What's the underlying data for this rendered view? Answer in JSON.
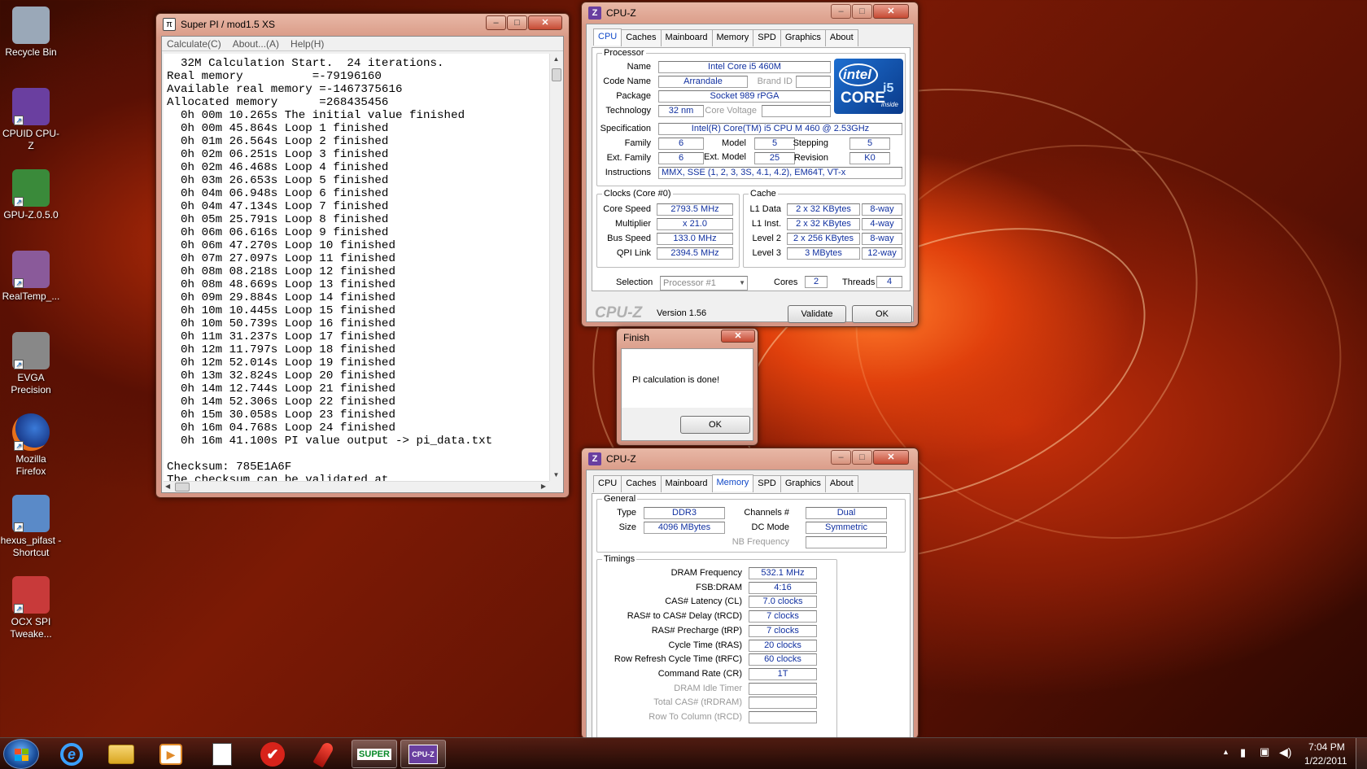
{
  "desktop": {
    "icons": [
      {
        "label_1": "Recycle Bin",
        "label_2": ""
      },
      {
        "label_1": "CPUID CPU-Z",
        "label_2": ""
      },
      {
        "label_1": "GPU-Z.0.5.0",
        "label_2": ""
      },
      {
        "label_1": "RealTemp_...",
        "label_2": ""
      },
      {
        "label_1": "EVGA",
        "label_2": "Precision"
      },
      {
        "label_1": "Mozilla",
        "label_2": "Firefox"
      },
      {
        "label_1": "hexus_pifast -",
        "label_2": "Shortcut"
      },
      {
        "label_1": "OCX SPI",
        "label_2": "Tweake..."
      }
    ]
  },
  "superpi": {
    "title": "Super PI / mod1.5 XS",
    "menu": [
      "Calculate(C)",
      "About...(A)",
      "Help(H)"
    ],
    "lines": [
      "  32M Calculation Start.  24 iterations.",
      "Real memory          =-79196160",
      "Available real memory =-1467375616",
      "Allocated memory      =268435456",
      "  0h 00m 10.265s The initial value finished",
      "  0h 00m 45.864s Loop 1 finished",
      "  0h 01m 26.564s Loop 2 finished",
      "  0h 02m 06.251s Loop 3 finished",
      "  0h 02m 46.468s Loop 4 finished",
      "  0h 03m 26.653s Loop 5 finished",
      "  0h 04m 06.948s Loop 6 finished",
      "  0h 04m 47.134s Loop 7 finished",
      "  0h 05m 25.791s Loop 8 finished",
      "  0h 06m 06.616s Loop 9 finished",
      "  0h 06m 47.270s Loop 10 finished",
      "  0h 07m 27.097s Loop 11 finished",
      "  0h 08m 08.218s Loop 12 finished",
      "  0h 08m 48.669s Loop 13 finished",
      "  0h 09m 29.884s Loop 14 finished",
      "  0h 10m 10.445s Loop 15 finished",
      "  0h 10m 50.739s Loop 16 finished",
      "  0h 11m 31.237s Loop 17 finished",
      "  0h 12m 11.797s Loop 18 finished",
      "  0h 12m 52.014s Loop 19 finished",
      "  0h 13m 32.824s Loop 20 finished",
      "  0h 14m 12.744s Loop 21 finished",
      "  0h 14m 52.306s Loop 22 finished",
      "  0h 15m 30.058s Loop 23 finished",
      "  0h 16m 04.768s Loop 24 finished",
      "  0h 16m 41.100s PI value output -> pi_data.txt",
      "",
      "Checksum: 785E1A6F",
      "The checksum can be validated at"
    ]
  },
  "cpuz_cpu": {
    "title": "CPU-Z",
    "tabs": [
      "CPU",
      "Caches",
      "Mainboard",
      "Memory",
      "SPD",
      "Graphics",
      "About"
    ],
    "processor_group": "Processor",
    "name_label": "Name",
    "name": "Intel Core i5 460M",
    "codename_label": "Code Name",
    "codename": "Arrandale",
    "brandid_label": "Brand ID",
    "brandid": "",
    "package_label": "Package",
    "package": "Socket 989 rPGA",
    "technology_label": "Technology",
    "technology": "32 nm",
    "corevoltage_label": "Core Voltage",
    "corevoltage": "",
    "spec_label": "Specification",
    "spec": "Intel(R) Core(TM) i5 CPU       M 460  @ 2.53GHz",
    "family_label": "Family",
    "family": "6",
    "model_label": "Model",
    "model": "5",
    "stepping_label": "Stepping",
    "stepping": "5",
    "extfamily_label": "Ext. Family",
    "extfamily": "6",
    "extmodel_label": "Ext. Model",
    "extmodel": "25",
    "revision_label": "Revision",
    "revision": "K0",
    "instructions_label": "Instructions",
    "instructions": "MMX, SSE (1, 2, 3, 3S, 4.1, 4.2), EM64T, VT-x",
    "logo": {
      "brand": "intel",
      "line": "CORE",
      "model": "i5",
      "tag": "inside"
    },
    "clocks_group": "Clocks (Core #0)",
    "corespeed_label": "Core Speed",
    "corespeed": "2793.5 MHz",
    "multiplier_label": "Multiplier",
    "multiplier": "x 21.0",
    "busspeed_label": "Bus Speed",
    "busspeed": "133.0 MHz",
    "qpilink_label": "QPI Link",
    "qpilink": "2394.5 MHz",
    "cache_group": "Cache",
    "l1d_label": "L1 Data",
    "l1d": "2 x 32 KBytes",
    "l1d_way": "8-way",
    "l1i_label": "L1 Inst.",
    "l1i": "2 x 32 KBytes",
    "l1i_way": "4-way",
    "l2_label": "Level 2",
    "l2": "2 x 256 KBytes",
    "l2_way": "8-way",
    "l3_label": "Level 3",
    "l3": "3 MBytes",
    "l3_way": "12-way",
    "selection_label": "Selection",
    "selection": "Processor #1",
    "cores_label": "Cores",
    "cores": "2",
    "threads_label": "Threads",
    "threads": "4",
    "brand_text": "CPU-Z",
    "version": "Version 1.56",
    "validate": "Validate",
    "ok": "OK"
  },
  "finish": {
    "title": "Finish",
    "message": "PI calculation is done!",
    "ok": "OK"
  },
  "cpuz_mem": {
    "title": "CPU-Z",
    "tabs": [
      "CPU",
      "Caches",
      "Mainboard",
      "Memory",
      "SPD",
      "Graphics",
      "About"
    ],
    "general_group": "General",
    "type_label": "Type",
    "type": "DDR3",
    "size_label": "Size",
    "size": "4096 MBytes",
    "channels_label": "Channels #",
    "channels": "Dual",
    "dcmode_label": "DC Mode",
    "dcmode": "Symmetric",
    "nbfreq_label": "NB Frequency",
    "nbfreq": "",
    "timings_group": "Timings",
    "timings": [
      {
        "label": "DRAM Frequency",
        "value": "532.1 MHz"
      },
      {
        "label": "FSB:DRAM",
        "value": "4:16"
      },
      {
        "label": "CAS# Latency (CL)",
        "value": "7.0 clocks"
      },
      {
        "label": "RAS# to CAS# Delay (tRCD)",
        "value": "7 clocks"
      },
      {
        "label": "RAS# Precharge (tRP)",
        "value": "7 clocks"
      },
      {
        "label": "Cycle Time (tRAS)",
        "value": "20 clocks"
      },
      {
        "label": "Row Refresh Cycle Time (tRFC)",
        "value": "60 clocks"
      },
      {
        "label": "Command Rate (CR)",
        "value": "1T"
      },
      {
        "label": "DRAM Idle Timer",
        "value": ""
      },
      {
        "label": "Total CAS# (tRDRAM)",
        "value": ""
      },
      {
        "label": "Row To Column (tRCD)",
        "value": ""
      }
    ]
  },
  "taskbar": {
    "superpi_label": "SUPER",
    "cpuz_label": "CPU-Z",
    "time": "7:04 PM",
    "date": "1/22/2011"
  },
  "colors": {
    "accent_blue": "#1030a0",
    "tab_active": "#1048c8",
    "intel_blue": "#1e6fd0"
  }
}
